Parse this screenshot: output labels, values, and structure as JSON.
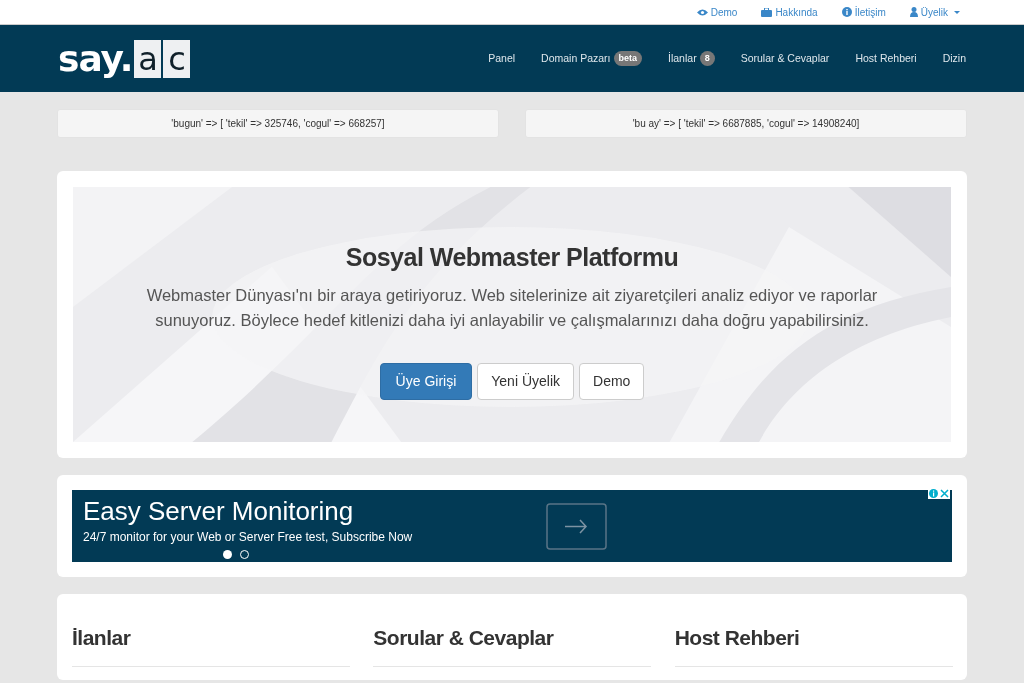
{
  "top_links": [
    {
      "label": "Demo",
      "dropdown": false
    },
    {
      "label": "Hakkında",
      "dropdown": false
    },
    {
      "label": "İletişim",
      "dropdown": false
    },
    {
      "label": "Üyelik",
      "dropdown": true
    }
  ],
  "logo": {
    "text": "say.",
    "tiles": [
      "a",
      "c"
    ]
  },
  "nav": [
    {
      "label": "Panel"
    },
    {
      "label": "Domain Pazarı",
      "badge": "beta"
    },
    {
      "label": "İlanlar",
      "badge": "8"
    },
    {
      "label": "Sorular & Cevaplar"
    },
    {
      "label": "Host Rehberi"
    },
    {
      "label": "Dizin"
    }
  ],
  "stats": [
    "'bugun' => [ 'tekil' => 325746, 'cogul' => 668257]",
    "'bu ay' => [ 'tekil' => 6687885, 'cogul' => 14908240]"
  ],
  "hero": {
    "title": "Sosyal Webmaster Platformu",
    "text": "Webmaster Dünyası'nı bir araya getiriyoruz. Web sitelerinize ait ziyaretçileri analiz ediyor ve raporlar sunuyoruz. Böylece hedef kitlenizi daha iyi anlayabilir ve çalışmalarınızı daha doğru yapabilirsiniz.",
    "buttons": [
      {
        "label": "Üye Girişi",
        "primary": true
      },
      {
        "label": "Yeni Üyelik",
        "primary": false
      },
      {
        "label": "Demo",
        "primary": false
      }
    ]
  },
  "ad": {
    "title": "Easy Server Monitoring",
    "text": "24/7 monitor for your Web or Server Free test, Subscribe Now",
    "dots": [
      {
        "selected": true
      },
      {
        "selected": false
      }
    ]
  },
  "sections": [
    "İlanlar",
    "Sorular & Cevaplar",
    "Host Rehberi"
  ]
}
